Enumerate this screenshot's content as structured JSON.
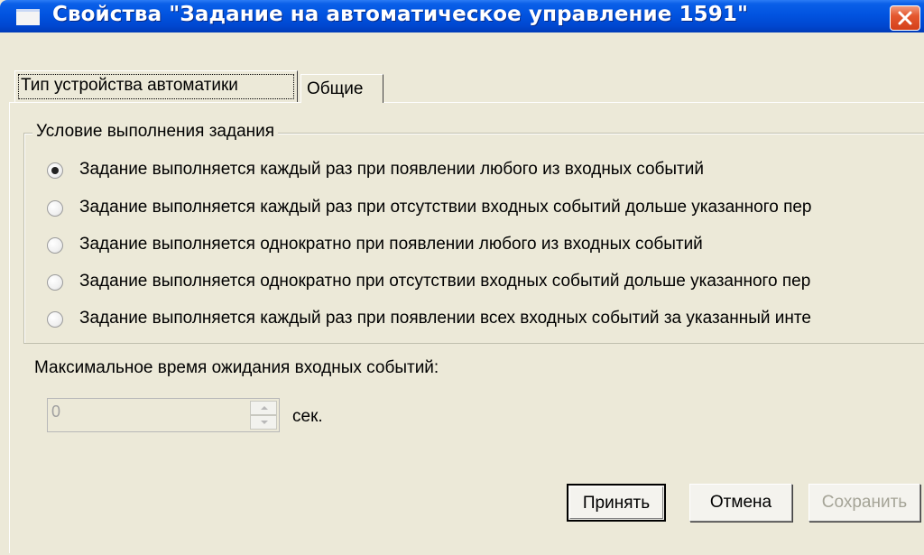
{
  "window": {
    "title": "Свойства \"Задание на автоматическое управление 1591\""
  },
  "tabs": [
    {
      "label": "Тип устройства автоматики",
      "active": true
    },
    {
      "label": "Общие",
      "active": false
    }
  ],
  "condition_group": {
    "legend": "Условие выполнения задания",
    "options": [
      {
        "label": "Задание выполняется каждый раз при появлении любого из входных событий",
        "checked": true
      },
      {
        "label": "Задание выполняется каждый раз при отсутствии входных событий дольше указанного пер",
        "checked": false
      },
      {
        "label": "Задание выполняется однократно при появлении любого из входных событий",
        "checked": false
      },
      {
        "label": "Задание выполняется однократно при отсутствии входных событий дольше указанного пер",
        "checked": false
      },
      {
        "label": "Задание выполняется каждый раз при появлении всех входных событий за указанный инте",
        "checked": false
      }
    ]
  },
  "timeout": {
    "label": "Максимальное время ожидания входных событий:",
    "value": "0",
    "unit": "сек."
  },
  "buttons": {
    "accept": "Принять",
    "cancel": "Отмена",
    "save": "Сохранить"
  },
  "colors": {
    "titlebar": "#0153e0",
    "face": "#ece9d8",
    "close": "#e4582f",
    "disabled_text": "#a5a497"
  }
}
